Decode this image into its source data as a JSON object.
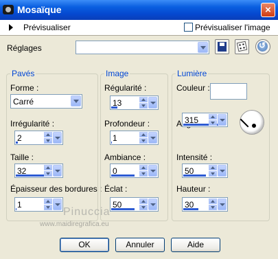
{
  "window": {
    "title": "Mosaïque",
    "close_glyph": "×"
  },
  "preview": {
    "label": "Prévisualiser",
    "checkbox_label": "Prévisualiser l'image",
    "checked": false
  },
  "settings": {
    "label": "Réglages",
    "value": ""
  },
  "groups": {
    "paves": {
      "title": "Pavés",
      "forme_label": "Forme :",
      "forme_value": "Carré",
      "irregularite_label": "Irrégularité :",
      "irregularite_value": "2",
      "taille_label": "Taille :",
      "taille_value": "32",
      "epaisseur_label": "Épaisseur des bordures :",
      "epaisseur_value": "1"
    },
    "image": {
      "title": "Image",
      "regularite_label": "Régularité :",
      "regularite_value": "13",
      "profondeur_label": "Profondeur :",
      "profondeur_value": "1",
      "ambiance_label": "Ambiance :",
      "ambiance_value": "0",
      "eclat_label": "Éclat :",
      "eclat_value": "50"
    },
    "lumiere": {
      "title": "Lumière",
      "couleur_label": "Couleur :",
      "couleur_value": "#ffffff",
      "angle_label": "Angle :",
      "angle_value": "315",
      "intensite_label": "Intensité :",
      "intensite_value": "50",
      "hauteur_label": "Hauteur :",
      "hauteur_value": "30"
    }
  },
  "watermark": {
    "line1": "Pinuccia",
    "line2": "www.maidiregrafica.eu"
  },
  "buttons": {
    "ok": "OK",
    "cancel": "Annuler",
    "help": "Aide"
  },
  "colors": {
    "titlebar": "#0a5fe0",
    "group_title": "#0046d5",
    "dialog_bg": "#ece9d8"
  }
}
